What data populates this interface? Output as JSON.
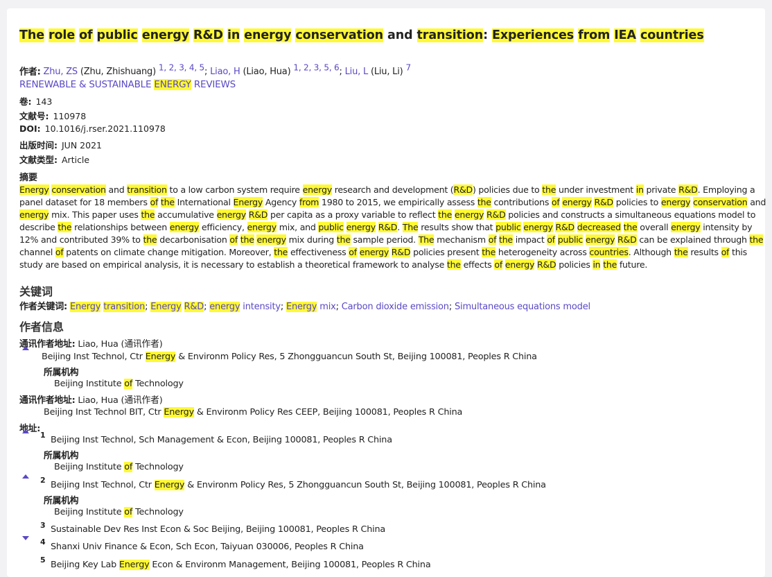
{
  "title": [
    "The",
    " ",
    "role",
    " ",
    "of",
    " ",
    "public",
    " ",
    "energy",
    " ",
    "R&D",
    " ",
    "in",
    " ",
    "energy",
    " ",
    "conservation",
    " and ",
    "transition",
    ": ",
    "Experiences",
    " ",
    "from",
    " ",
    "IEA",
    " ",
    "countries"
  ],
  "authors": {
    "label": "作者:",
    "list": [
      {
        "abbr": "Zhu, ZS",
        "full": "(Zhu, Zhishuang)",
        "refs": "1, 2, 3, 4, 5",
        "sep": ";"
      },
      {
        "abbr": "Liao, H",
        "full": "(Liao, Hua)",
        "refs": "1, 2, 3, 5, 6",
        "sep": ";"
      },
      {
        "abbr": "Liu, L",
        "full": "(Liu, Li)",
        "refs": "7",
        "sep": ""
      }
    ]
  },
  "journal": {
    "pre": "RENEWABLE & SUSTAINABLE ",
    "hl": "ENERGY",
    "post": " REVIEWS"
  },
  "meta": {
    "volume_label": "卷:",
    "volume": "143",
    "article_no_label": "文献号:",
    "article_no": "110978",
    "doi_label": "DOI:",
    "doi": "10.1016/j.rser.2021.110978",
    "pubdate_label": "出版时间:",
    "pubdate": "JUN 2021",
    "doctype_label": "文献类型:",
    "doctype": "Article"
  },
  "abstract_label": "摘要",
  "abstract_lines": [
    "Energy conservation and transition to a low carbon system require energy research and development (R&D) policies due to the under investment in private R&D. Employing a",
    "panel dataset for 18 members of the International Energy Agency from 1980 to 2015, we empirically assess the contributions of energy R&D policies to energy conservation and",
    "energy mix. This paper uses the accumulative energy R&D per capita as a proxy variable to reflect the energy R&D policies and constructs a simultaneous equations model to",
    "describe the relationships between energy efficiency, energy mix, and public energy R&D. The results show that public energy R&D decreased the overall energy intensity by",
    "12% and contributed 39% to the decarbonisation of the energy mix during the sample period. The mechanism of the impact of public energy R&D can be explained through the",
    "channel of patents on climate change mitigation. Moreover, the effectiveness of energy R&D policies present the heterogeneity across countries. Although the results of this",
    "study are based on empirical analysis, it is necessary to establish a theoretical framework to analyse the effects of energy R&D policies in the future."
  ],
  "keywords": {
    "section_title": "关键词",
    "label": "作者关键词:",
    "items": [
      {
        "parts": [
          [
            "Energy",
            true
          ],
          [
            " ",
            false
          ],
          [
            "transition",
            true
          ]
        ]
      },
      {
        "parts": [
          [
            "Energy",
            true
          ],
          [
            " ",
            false
          ],
          [
            "R&D",
            true
          ]
        ]
      },
      {
        "parts": [
          [
            "energy",
            true
          ],
          [
            " intensity",
            false
          ]
        ]
      },
      {
        "parts": [
          [
            "Energy",
            true
          ],
          [
            " mix",
            false
          ]
        ]
      },
      {
        "parts": [
          [
            "Carbon dioxide emission",
            false
          ]
        ]
      },
      {
        "parts": [
          [
            "Simultaneous equations model",
            false
          ]
        ]
      }
    ]
  },
  "author_info": {
    "section_title": "作者信息",
    "corr_label": "通讯作者地址:",
    "corr1_name": "Liao, Hua",
    "corr_tag": "(通讯作者)",
    "corr1_addr": "Beijing Inst Technol, Ctr Energy & Environm Policy Res, 5 Zhongguancun South St, Beijing 100081, Peoples R China",
    "affil_label": "所属机构",
    "affil_name": "Beijing Institute of Technology",
    "corr2_name": "Liao, Hua",
    "corr2_addr": "Beijing Inst Technol BIT, Ctr Energy & Environm Policy Res CEEP, Beijing 100081, Peoples R China",
    "addr_label": "地址:",
    "addresses": [
      {
        "num": "1",
        "text": "Beijing Inst Technol, Sch Management & Econ, Beijing 100081, Peoples R China"
      },
      {
        "num": "2",
        "text": "Beijing Inst Technol, Ctr Energy & Environm Policy Res, 5 Zhongguancun South St, Beijing 100081, Peoples R China"
      },
      {
        "num": "3",
        "text": "Sustainable Dev Res Inst Econ & Soc Beijing, Beijing 100081, Peoples R China"
      },
      {
        "num": "4",
        "text": "Shanxi Univ Finance & Econ, Sch Econ, Taiyuan 030006, Peoples R China"
      },
      {
        "num": "5",
        "text": "Beijing Key Lab Energy Econ & Environm Management, Beijing 100081, Peoples R China"
      }
    ]
  },
  "highlight_words": [
    "Energy",
    "energy",
    "conservation",
    "transition",
    "R&D",
    "the",
    "The",
    "in",
    "of",
    "public",
    "from",
    "decreased",
    "countries"
  ],
  "colors": {
    "highlight": "#fff933",
    "link": "#5a49c4",
    "toggle": "#5a49c4"
  },
  "icons": {
    "expand_open": "triangle-up-icon",
    "expand_closed": "triangle-down-icon"
  }
}
